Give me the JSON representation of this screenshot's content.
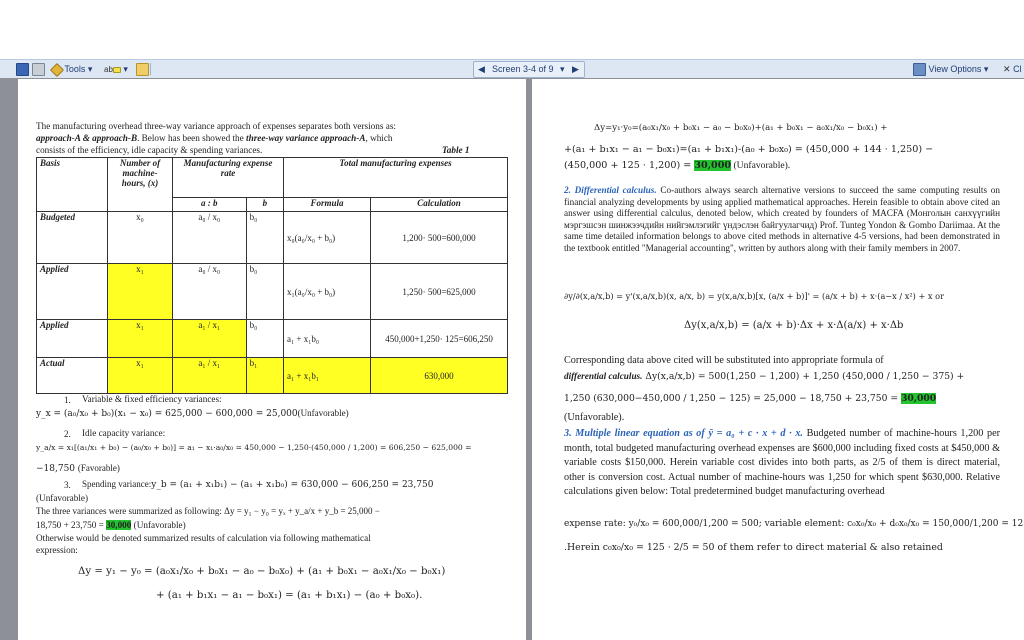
{
  "toolbar": {
    "tools_label": "Tools",
    "highlight_label": "ab",
    "screen_label": "Screen 3-4 of 9",
    "view_options_label": "View Options",
    "close_label": "Cl"
  },
  "left": {
    "intro_1": "The manufacturing overhead three-way variance approach of expenses separates both versions as:",
    "intro_2a": "approach-A & approach-B",
    "intro_2b": ". Below has been showed the ",
    "intro_2c": "three-way variance approach-A",
    "intro_2d": ", which",
    "intro_3": "consists of the efficiency, idle capacity & spending variances.",
    "table_caption": "Table 1",
    "table": {
      "h_basis": "Basis",
      "h_hours": "Number of machine-hours, (x)",
      "h_rate": "Manufacturing expense rate",
      "h_total": "Total manufacturing expenses",
      "h_ab": "a : b",
      "h_b": "b",
      "h_formula": "Formula",
      "h_calc": "Calculation",
      "rows": [
        {
          "basis": "Budgeted",
          "x": "x₀",
          "a": "a₀ / x₀",
          "b": "b₀",
          "formula": "x₀(a₀/x₀ + b₀)",
          "calc": "1,200· 500=600,000"
        },
        {
          "basis": "Applied",
          "x": "x₁",
          "a": "a₀ / x₀",
          "b": "b₀",
          "formula": "x₁(a₀/x₀ + b₀)",
          "calc": "1,250· 500=625,000"
        },
        {
          "basis": "Applied",
          "x": "x₁",
          "a": "a₁ / x₁",
          "b": "b₀",
          "formula": "a₁ + x₁b₀",
          "calc": "450,000+1,250· 125=606,250"
        },
        {
          "basis": "Actual",
          "x": "x₁",
          "a": "a₁ / x₁",
          "b": "b₁",
          "formula": "a₁ + x₁b₁",
          "calc": "630,000"
        }
      ]
    },
    "item1_num": "1.",
    "item1_title": "Variable & fixed efficiency variances:",
    "item1_formula": "y_x = (a₀/x₀ + b₀)(x₁ − x₀) = 625,000 − 600,000 = 25,000",
    "item1_note": "(Unfavorable)",
    "item2_num": "2.",
    "item2_title": "Idle capacity variance:",
    "item2_formula": "y_a/x = x₁[(a₁/x₁ + b₀) − (a₀/x₀ + b₀)] = a₁ − x₁·a₀/x₀ = 450,000 − 1,250·(450,000 / 1,200) = 606,250 − 625,000 =",
    "item2_result": "−18,750",
    "item2_note": "(Favorable)",
    "item3_num": "3.",
    "item3_title": "Spending variance:",
    "item3_formula": "y_b = (a₁ + x₁b₁) − (a₁ + x₁b₀) = 630,000 − 606,250 = 23,750",
    "item3_note": "(Unfavorable)",
    "summary_1": "The three variances were summarized as following: Δy = y₁ − y₀ = yₓ + y_a/x + y_b = 25,000 −",
    "summary_2a": "18,750 + 23,750 = ",
    "summary_value": "30,000",
    "summary_2b": " (Unfavorable)",
    "summary_3": "Otherwise would be denoted summarized results of calculation via following mathematical",
    "summary_4": "expression:",
    "big_formula_1": "Δy = y₁ − y₀ = (a₀x₁/x₀ + b₀x₁ − a₀ − b₀x₀) + (a₁ + b₀x₁ − a₀x₁/x₀ − b₀x₁)",
    "big_formula_2": "+ (a₁ + b₁x₁ − a₁ − b₀x₁) = (a₁ + b₁x₁) − (a₀ + b₀x₀)."
  },
  "right": {
    "eq_1": "Δy=y₁·y₀=(a₀x₁/x₀ + b₀x₁ − a₀ − b₀x₀)+(a₁ + b₀x₁ − a₀x₁/x₀ − b₀x₁) +",
    "eq_2": "+(a₁ + b₁x₁ − a₁ − b₀x₁)=(a₁ + b₁x₁)-(a₀ + b₀x₀) = (450,000 + 144 · 1,250) −",
    "eq_3a": "(450,000 + 125 · 1,200) = ",
    "eq_3_value": "30,000",
    "eq_3b": " (Unfavorable).",
    "sec2_title": "2. Differential calculus.",
    "sec2_p1": "Co-authors always search alternative versions to succeed the same computing results on financial analyzing developments by using applied mathematical approaches. Herein feasible to obtain above cited an answer using differential calculus, denoted below, which created by founders of MACFA (Монголын санхүүгийн мэргэшсэн шинжээчдийн нийгэмлэгийг үндэслэн байгуулагчид) Prof. Tunteg Yondon & Gombo Dariimaa. At the same time detailed information belongs to above cited methods in alternative 4-5 versions, had been demonstrated in the textbook entitled \"Managerial accounting\", written by authors along with their family members in 2007.",
    "diff_eq_1": "∂y/∂(x,a/x,b) = y'(x,a/x,b)(x, a/x, b) = y(x,a/x,b)[x, (a/x + b)]' = (a/x + b) + x·(a−x / x²) + x or",
    "diff_eq_2": "Δy(x,a/x,b) = (a/x + b)·Δx + x·Δ(a/x) + x·Δb",
    "corr_1": "Corresponding data above cited will be substituted into appropriate formula of",
    "corr_2a": "differential calculus.",
    "corr_2b": " Δy(x,a/x,b) = 500(1,250 − 1,200) + 1,250 (450,000 / 1,250 − 375) +",
    "corr_3a": "1,250 (630,000−450,000 / 1,250 − 125) = 25,000 − 18,750 + 23,750 = ",
    "corr_3_value": "30,000",
    "corr_4": "(Unfavorable).",
    "sec3_title": "3. Multiple linear equation as of ȳ = a₀ + c · x + d · x.",
    "sec3_p1": "Budgeted number of machine-hours 1,200 per month, total budgeted manufacturing overhead expenses are $600,000 including fixed costs at $450,000 & variable costs $150,000. Herein variable cost divides into both parts, as 2/5 of them is direct material, other is conversion cost. Actual number of machine-hours was 1,250 for which spent $630,000. Relative calculations given below: Total predetermined budget manufacturing overhead",
    "rate_line": "expense rate: y₀/x₀ = 600,000/1,200 = 500; variable element: c₀x₀/x₀ + d₀x₀/x₀ = 150,000/1,200 = 125",
    "last_line": ".Herein c₀x₀/x₀ = 125 · 2/5 = 50 of them refer to direct material & also retained"
  }
}
